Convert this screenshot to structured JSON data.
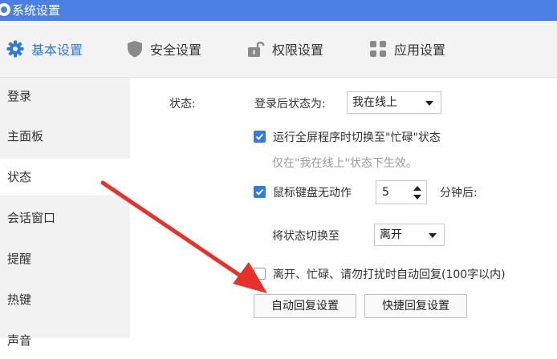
{
  "window": {
    "title": "系统设置"
  },
  "tabs": [
    {
      "label": "基本设置",
      "icon": "gear-icon",
      "active": true
    },
    {
      "label": "安全设置",
      "icon": "shield-icon",
      "active": false
    },
    {
      "label": "权限设置",
      "icon": "lock-icon",
      "active": false
    },
    {
      "label": "应用设置",
      "icon": "apps-grid-icon",
      "active": false
    }
  ],
  "sidebar": {
    "items": [
      {
        "label": "登录"
      },
      {
        "label": "主面板"
      },
      {
        "label": "状态",
        "active": true
      },
      {
        "label": "会话窗口"
      },
      {
        "label": "提醒"
      },
      {
        "label": "热键"
      },
      {
        "label": "声音"
      }
    ]
  },
  "status": {
    "section_label": "状态:",
    "after_login_label": "登录后状态为:",
    "after_login_value": "我在线上",
    "fullscreen_checkbox_label": "运行全屏程序时切换至\"忙碌\"状态",
    "fullscreen_checked": true,
    "fullscreen_hint": "仅在\"我在线上\"状态下生效。",
    "idle_checkbox_label": "鼠标键盘无动作",
    "idle_checked": true,
    "idle_minutes": "5",
    "idle_suffix": "分钟后:",
    "switch_to_label": "将状态切换至",
    "switch_to_value": "离开",
    "auto_reply_checkbox_label": "离开、忙碌、请勿打扰时自动回复(100字以内)",
    "auto_reply_checked": false,
    "auto_reply_settings_button": "自动回复设置",
    "quick_reply_settings_button": "快捷回复设置"
  },
  "colors": {
    "titlebar": "#4a80e3",
    "accent": "#2e7ad9",
    "checkbox": "#2f7ce0",
    "annotation_arrow": "#e8312a"
  }
}
